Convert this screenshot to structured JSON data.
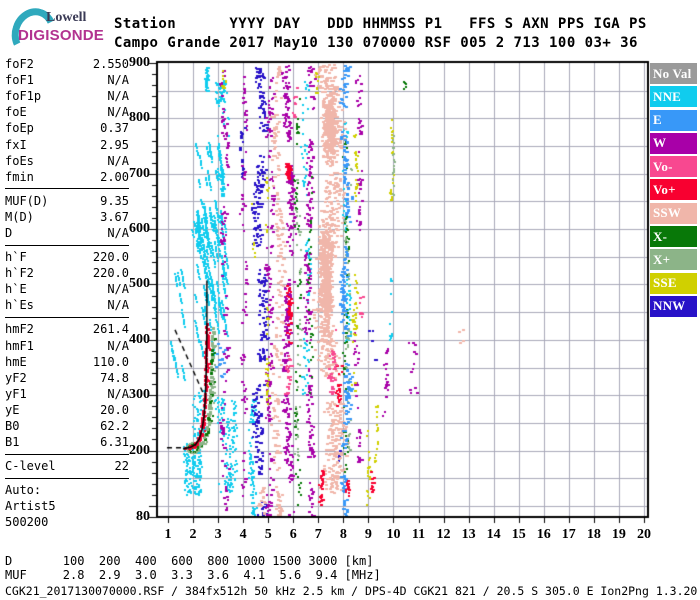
{
  "logo": {
    "line1": "Lowell",
    "line2": "DIGISONDE"
  },
  "header": {
    "line1": "Station      YYYY DAY   DDD HHMMSS P1   FFS S AXN PPS IGA PS",
    "line2": "Campo Grande 2017 May10 130 070000 RSF 005 2 713 100 03+ 36"
  },
  "params": {
    "groups": [
      {
        "rows": [
          {
            "label": "foF2",
            "value": "2.550"
          },
          {
            "label": "foF1",
            "value": "N/A"
          },
          {
            "label": "foF1p",
            "value": "N/A"
          },
          {
            "label": "foE",
            "value": "N/A"
          },
          {
            "label": "foEp",
            "value": "0.37"
          },
          {
            "label": "fxI",
            "value": "2.95"
          },
          {
            "label": "foEs",
            "value": "N/A"
          },
          {
            "label": "fmin",
            "value": "2.00"
          }
        ]
      },
      {
        "rows": [
          {
            "label": "MUF(D)",
            "value": "9.35"
          },
          {
            "label": "M(D)",
            "value": "3.67"
          },
          {
            "label": "D",
            "value": "N/A"
          }
        ]
      },
      {
        "rows": [
          {
            "label": "h`F",
            "value": "220.0"
          },
          {
            "label": "h`F2",
            "value": "220.0"
          },
          {
            "label": "h`E",
            "value": "N/A"
          },
          {
            "label": "h`Es",
            "value": "N/A"
          }
        ]
      },
      {
        "rows": [
          {
            "label": "hmF2",
            "value": "261.4"
          },
          {
            "label": "hmF1",
            "value": "N/A"
          },
          {
            "label": "hmE",
            "value": "110.0"
          },
          {
            "label": "yF2",
            "value": "74.8"
          },
          {
            "label": "yF1",
            "value": "N/A"
          },
          {
            "label": "yE",
            "value": "20.0"
          },
          {
            "label": "B0",
            "value": "62.2"
          },
          {
            "label": "B1",
            "value": "6.31"
          }
        ]
      },
      {
        "rows": [
          {
            "label": "C-level",
            "value": "22"
          }
        ]
      }
    ],
    "footer_lines": [
      "Auto:",
      "Artist5",
      "500200"
    ]
  },
  "legend": {
    "items": [
      {
        "label": "No Val",
        "color": "#9a9a9a"
      },
      {
        "label": "NNE",
        "color": "#10ccee"
      },
      {
        "label": "E",
        "color": "#3898f8"
      },
      {
        "label": "W",
        "color": "#a800a8"
      },
      {
        "label": "Vo-",
        "color": "#f84890"
      },
      {
        "label": "Vo+",
        "color": "#f80030"
      },
      {
        "label": "SSW",
        "color": "#f0b6aa"
      },
      {
        "label": "X-",
        "color": "#087808"
      },
      {
        "label": "X+",
        "color": "#8cb488"
      },
      {
        "label": "SSE",
        "color": "#d0d000"
      },
      {
        "label": "NNW",
        "color": "#2812c8"
      }
    ]
  },
  "bottom": {
    "d_row": "D       100  200  400  600  800 1000 1500 3000 [km]",
    "muf_row": "MUF     2.8  2.9  3.0  3.3  3.6  4.1  5.6  9.4 [MHz]",
    "footer": "CGK21_2017130070000.RSF / 384fx512h 50 kHz 2.5 km / DPS-4D CGK21 821 / 20.5 S 305.0 E Ion2Png 1.3.20"
  },
  "chart_data": {
    "type": "scatter",
    "title": "Digisonde RSF ionogram, Campo Grande, 2017 May10 (day 130) 07:00:00",
    "x_axis": {
      "unit": "MHz",
      "min": 1,
      "max": 20,
      "ticks": [
        1,
        2,
        3,
        4,
        5,
        6,
        7,
        8,
        9,
        10,
        11,
        12,
        13,
        14,
        15,
        16,
        17,
        18,
        19,
        20
      ]
    },
    "y_axis": {
      "unit": "km",
      "min": 80,
      "max": 900,
      "labels": [
        900,
        800,
        700,
        600,
        500,
        400,
        300,
        200,
        80
      ],
      "grid_step_km": 50,
      "minor_tick_km": 20
    },
    "grid": true,
    "legend_position": "right",
    "palette": {
      "NNE": "#10ccee",
      "E": "#3898f8",
      "W": "#a800a8",
      "Vo-": "#f84890",
      "Vo+": "#f80030",
      "SSW": "#f0b6aa",
      "X-": "#087808",
      "X+": "#8cb488",
      "SSE": "#d0d000",
      "NNW": "#2812c8",
      "NoVal": "#9a9a9a"
    },
    "band_format": [
      "status",
      "f_min_MHz",
      "f_max_MHz",
      "h_min_km",
      "h_max_km",
      "count",
      "pattern(u=uniform,c=column,s=streaks,b=blob,w=wide-wavy)"
    ],
    "bands": [
      [
        "NNE",
        1.05,
        1.6,
        350,
        560,
        60,
        "s"
      ],
      [
        "NNE",
        1.6,
        2.3,
        120,
        215,
        150,
        "u"
      ],
      [
        "NNE",
        1.95,
        2.45,
        225,
        310,
        50,
        "u"
      ],
      [
        "NNE",
        2.8,
        3.7,
        120,
        300,
        130,
        "c"
      ],
      [
        "NNE",
        2.05,
        3.3,
        395,
        640,
        380,
        "s"
      ],
      [
        "NNE",
        1.9,
        3.1,
        600,
        760,
        240,
        "s"
      ],
      [
        "NNE",
        2.75,
        3.4,
        770,
        875,
        110,
        "c"
      ],
      [
        "NNE",
        2.35,
        2.6,
        848,
        893,
        36,
        "c"
      ],
      [
        "NNE",
        4.15,
        4.5,
        85,
        300,
        100,
        "c"
      ],
      [
        "NNE",
        6.3,
        6.7,
        300,
        870,
        110,
        "c"
      ],
      [
        "NNE",
        7.9,
        8.25,
        400,
        800,
        80,
        "c"
      ],
      [
        "NNE",
        9.78,
        9.95,
        400,
        520,
        20,
        "c"
      ],
      [
        "NNE",
        3.3,
        3.75,
        130,
        300,
        70,
        "c"
      ],
      [
        "NNW",
        4.35,
        4.95,
        80,
        898,
        400,
        "w"
      ],
      [
        "NNW",
        3.85,
        4.1,
        690,
        800,
        28,
        "c"
      ],
      [
        "NNW",
        8.95,
        9.3,
        340,
        420,
        24,
        "c"
      ],
      [
        "NNW",
        7.75,
        8.05,
        180,
        245,
        18,
        "c"
      ],
      [
        "W",
        3.05,
        3.4,
        90,
        890,
        170,
        "c"
      ],
      [
        "W",
        3.85,
        4.15,
        100,
        880,
        110,
        "c"
      ],
      [
        "W",
        4.85,
        5.25,
        80,
        898,
        190,
        "c"
      ],
      [
        "W",
        5.55,
        6.0,
        80,
        898,
        400,
        "w"
      ],
      [
        "W",
        6.4,
        6.8,
        80,
        898,
        250,
        "w"
      ],
      [
        "W",
        8.35,
        8.7,
        180,
        420,
        46,
        "c"
      ],
      [
        "W",
        8.45,
        8.75,
        580,
        880,
        55,
        "c"
      ],
      [
        "W",
        9.5,
        9.75,
        260,
        400,
        24,
        "c"
      ],
      [
        "W",
        10.5,
        10.9,
        300,
        400,
        13,
        "u"
      ],
      [
        "SSW",
        5.1,
        5.6,
        80,
        898,
        280,
        "c"
      ],
      [
        "SSW",
        6.8,
        8.0,
        80,
        898,
        850,
        "w"
      ],
      [
        "SSW",
        6.9,
        7.6,
        390,
        630,
        500,
        "b"
      ],
      [
        "SSW",
        7.05,
        7.8,
        690,
        880,
        280,
        "b"
      ],
      [
        "SSW",
        12.55,
        12.8,
        385,
        420,
        4,
        "u"
      ],
      [
        "SSW",
        4.55,
        4.85,
        85,
        135,
        22,
        "u"
      ],
      [
        "SSE",
        4.85,
        5.1,
        280,
        460,
        36,
        "c"
      ],
      [
        "SSE",
        4.8,
        5.0,
        590,
        700,
        26,
        "c"
      ],
      [
        "SSE",
        8.3,
        8.6,
        300,
        520,
        55,
        "c"
      ],
      [
        "SSE",
        8.3,
        8.55,
        640,
        780,
        36,
        "c"
      ],
      [
        "SSE",
        8.85,
        9.05,
        100,
        260,
        28,
        "c"
      ],
      [
        "SSE",
        9.15,
        9.4,
        140,
        300,
        30,
        "c"
      ],
      [
        "SSE",
        9.8,
        10.0,
        650,
        800,
        36,
        "c"
      ],
      [
        "SSE",
        3.1,
        3.3,
        855,
        890,
        10,
        "u"
      ],
      [
        "SSE",
        6.85,
        7.0,
        845,
        885,
        10,
        "u"
      ],
      [
        "SSE",
        4.3,
        4.5,
        550,
        650,
        18,
        "c"
      ],
      [
        "X-",
        6.0,
        6.3,
        100,
        840,
        100,
        "c"
      ],
      [
        "X-",
        7.95,
        8.2,
        150,
        760,
        90,
        "c"
      ],
      [
        "X-",
        10.35,
        10.55,
        845,
        870,
        5,
        "u"
      ],
      [
        "X-",
        6.55,
        6.75,
        300,
        700,
        36,
        "c"
      ],
      [
        "X+",
        6.05,
        6.35,
        150,
        700,
        65,
        "c"
      ],
      [
        "X+",
        8.0,
        8.3,
        200,
        720,
        75,
        "c"
      ],
      [
        "X+",
        9.85,
        10.05,
        655,
        785,
        24,
        "c"
      ],
      [
        "E",
        7.85,
        8.25,
        80,
        898,
        300,
        "w"
      ],
      [
        "E",
        2.85,
        3.25,
        330,
        395,
        18,
        "u"
      ],
      [
        "Vo+",
        5.6,
        5.92,
        380,
        500,
        55,
        "c"
      ],
      [
        "Vo+",
        5.62,
        5.9,
        688,
        732,
        40,
        "b"
      ],
      [
        "Vo+",
        7.0,
        7.25,
        100,
        165,
        26,
        "c"
      ],
      [
        "Vo+",
        8.0,
        8.2,
        100,
        150,
        18,
        "c"
      ],
      [
        "Vo+",
        9.05,
        9.3,
        105,
        165,
        22,
        "c"
      ],
      [
        "Vo+",
        7.55,
        7.9,
        280,
        360,
        36,
        "c"
      ],
      [
        "Vo-",
        7.3,
        7.7,
        300,
        430,
        46,
        "c"
      ],
      [
        "Vo-",
        5.55,
        5.9,
        300,
        385,
        32,
        "c"
      ],
      [
        "Vo-",
        5.95,
        6.15,
        800,
        860,
        12,
        "u"
      ],
      [
        "Vo-",
        8.6,
        8.75,
        430,
        480,
        9,
        "u"
      ]
    ],
    "traces": {
      "o_mode_f_h": [
        [
          1.72,
          205
        ],
        [
          1.82,
          206
        ],
        [
          1.92,
          207
        ],
        [
          2.02,
          209
        ],
        [
          2.1,
          212
        ],
        [
          2.18,
          217
        ],
        [
          2.25,
          224
        ],
        [
          2.31,
          233
        ],
        [
          2.36,
          245
        ],
        [
          2.4,
          260
        ],
        [
          2.44,
          278
        ],
        [
          2.47,
          300
        ],
        [
          2.5,
          325
        ],
        [
          2.52,
          352
        ],
        [
          2.53,
          378
        ],
        [
          2.54,
          402
        ],
        [
          2.55,
          425
        ]
      ],
      "x_mode_f_h": [
        [
          2.02,
          205
        ],
        [
          2.12,
          206
        ],
        [
          2.22,
          208
        ],
        [
          2.32,
          212
        ],
        [
          2.42,
          218
        ],
        [
          2.5,
          227
        ],
        [
          2.57,
          240
        ],
        [
          2.62,
          256
        ],
        [
          2.66,
          276
        ],
        [
          2.7,
          300
        ],
        [
          2.73,
          328
        ],
        [
          2.76,
          360
        ],
        [
          2.78,
          392
        ],
        [
          2.8,
          420
        ]
      ],
      "fit_f_h": [
        [
          1.6,
          203
        ],
        [
          1.9,
          206
        ],
        [
          2.1,
          211
        ],
        [
          2.25,
          221
        ],
        [
          2.36,
          238
        ],
        [
          2.44,
          262
        ],
        [
          2.49,
          295
        ],
        [
          2.52,
          335
        ],
        [
          2.54,
          380
        ],
        [
          2.553,
          430
        ]
      ],
      "fof2_asymptote": {
        "f": 2.553,
        "h1": 430,
        "h2": 507
      },
      "muf_dashed_f_h": [
        [
          1.28,
          418
        ],
        [
          2.44,
          300
        ]
      ],
      "baseline_dashed_f_h": [
        [
          0.96,
          205
        ],
        [
          1.7,
          205
        ]
      ],
      "foot_oval": {
        "f_center": 1.97,
        "h_center": 206,
        "f_radius": 0.24,
        "h_radius": 9
      }
    }
  }
}
